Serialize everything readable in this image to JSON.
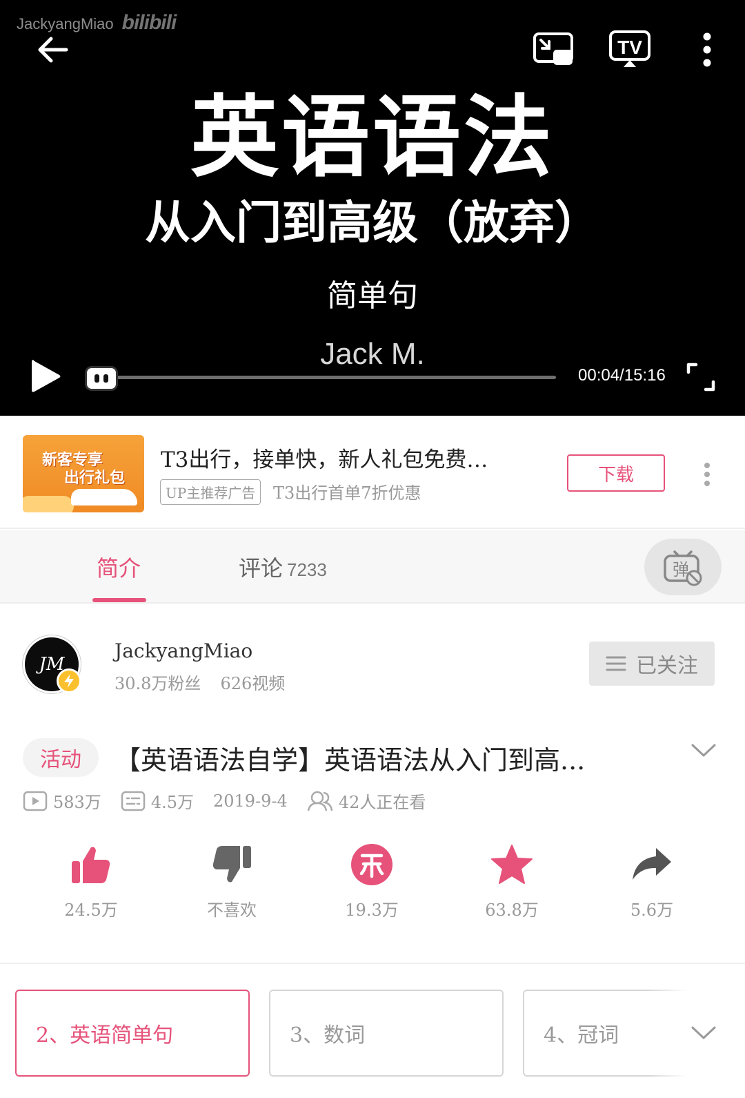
{
  "player": {
    "watermark_user": "JackyangMiao",
    "watermark_logo": "bilibili",
    "title_line1": "英语语法",
    "title_line2": "从入门到高级（放弃）",
    "title_line3": "简单句",
    "author": "Jack M.",
    "time": "00:04/15:16",
    "progress": 0.0044,
    "icons": [
      "back-arrow-icon",
      "pip-icon",
      "tv-cast-icon",
      "more-vertical-icon",
      "play-icon",
      "fullscreen-icon"
    ]
  },
  "ad": {
    "thumb_line1": "新客专享",
    "thumb_line2": "出行礼包",
    "title": "T3出行，接单快，新人礼包免费…",
    "badge": "UP主推荐广告",
    "subtitle": "T3出行首单7折优惠",
    "download_label": "下载"
  },
  "tabs": {
    "intro": "简介",
    "comments": "评论",
    "comments_count": "7233",
    "danmaku_icon": "弹"
  },
  "uploader": {
    "avatar_text": "JM",
    "name": "JackyangMiao",
    "fans": "30.8万粉丝",
    "videos": "626视频",
    "follow_label": "已关注"
  },
  "video": {
    "tag": "活动",
    "title": "【英语语法自学】英语语法从入门到高...",
    "views": "583万",
    "danmaku": "4.5万",
    "date": "2019-9-4",
    "watching": "42人正在看"
  },
  "actions": {
    "like": "24.5万",
    "dislike": "不喜欢",
    "coin": "19.3万",
    "favorite": "63.8万",
    "share": "5.6万"
  },
  "episodes": [
    {
      "label": "2、英语简单句"
    },
    {
      "label": "3、数词"
    },
    {
      "label": "4、冠词"
    }
  ],
  "colors": {
    "accent": "#e6527a",
    "player_bg": "#000000",
    "muted": "#999999"
  }
}
